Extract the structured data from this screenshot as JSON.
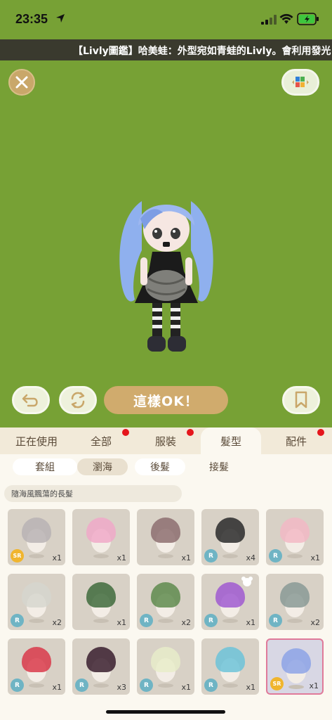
{
  "status": {
    "time": "23:35"
  },
  "ticker": {
    "text": "【Livly圖鑑】哈美蛙：外型宛如青蛙的Livly。會利用發光"
  },
  "stage": {
    "ok_label": "這樣OK！"
  },
  "main_tabs": [
    {
      "label": "正在使用",
      "dot": false
    },
    {
      "label": "全部",
      "dot": true
    },
    {
      "label": "服裝",
      "dot": true
    },
    {
      "label": "髮型",
      "dot": false,
      "active": true
    },
    {
      "label": "配件",
      "dot": true
    }
  ],
  "sub_tabs": [
    {
      "label": "套組"
    },
    {
      "label": "瀏海",
      "active": true
    },
    {
      "label": "後髮"
    },
    {
      "label": "接髮"
    }
  ],
  "description": "隨海風飄蕩的長髮",
  "items": [
    {
      "hair": "#b9b3b4",
      "rarity": "SR",
      "count": "x1"
    },
    {
      "hair": "#f0a9c8",
      "rarity": "",
      "count": "x1"
    },
    {
      "hair": "#8d6f70",
      "rarity": "",
      "count": "x1"
    },
    {
      "hair": "#2a2a2a",
      "rarity": "R",
      "count": "x4"
    },
    {
      "hair": "#f2b8c4",
      "rarity": "R",
      "count": "x1"
    },
    {
      "hair": "#d6d6ce",
      "rarity": "R",
      "count": "x2"
    },
    {
      "hair": "#3f6b3c",
      "rarity": "",
      "count": "x1"
    },
    {
      "hair": "#5f8b4e",
      "rarity": "R",
      "count": "x2"
    },
    {
      "hair": "#a05ad0",
      "rarity": "R",
      "count": "x1",
      "bear": true
    },
    {
      "hair": "#8a9a95",
      "rarity": "R",
      "count": "x2"
    },
    {
      "hair": "#d93a4a",
      "rarity": "R",
      "count": "x1"
    },
    {
      "hair": "#3a1e2e",
      "rarity": "R",
      "count": "x3"
    },
    {
      "hair": "#e7ecc9",
      "rarity": "R",
      "count": "x1"
    },
    {
      "hair": "#6dc3d8",
      "rarity": "R",
      "count": "x1"
    },
    {
      "hair": "#8da3e6",
      "rarity": "SR",
      "count": "x1",
      "selected": true
    }
  ],
  "colors": {
    "stage_green": "#77a135",
    "ok_button": "#d0ab6d",
    "notification_dot": "#e5161c"
  }
}
